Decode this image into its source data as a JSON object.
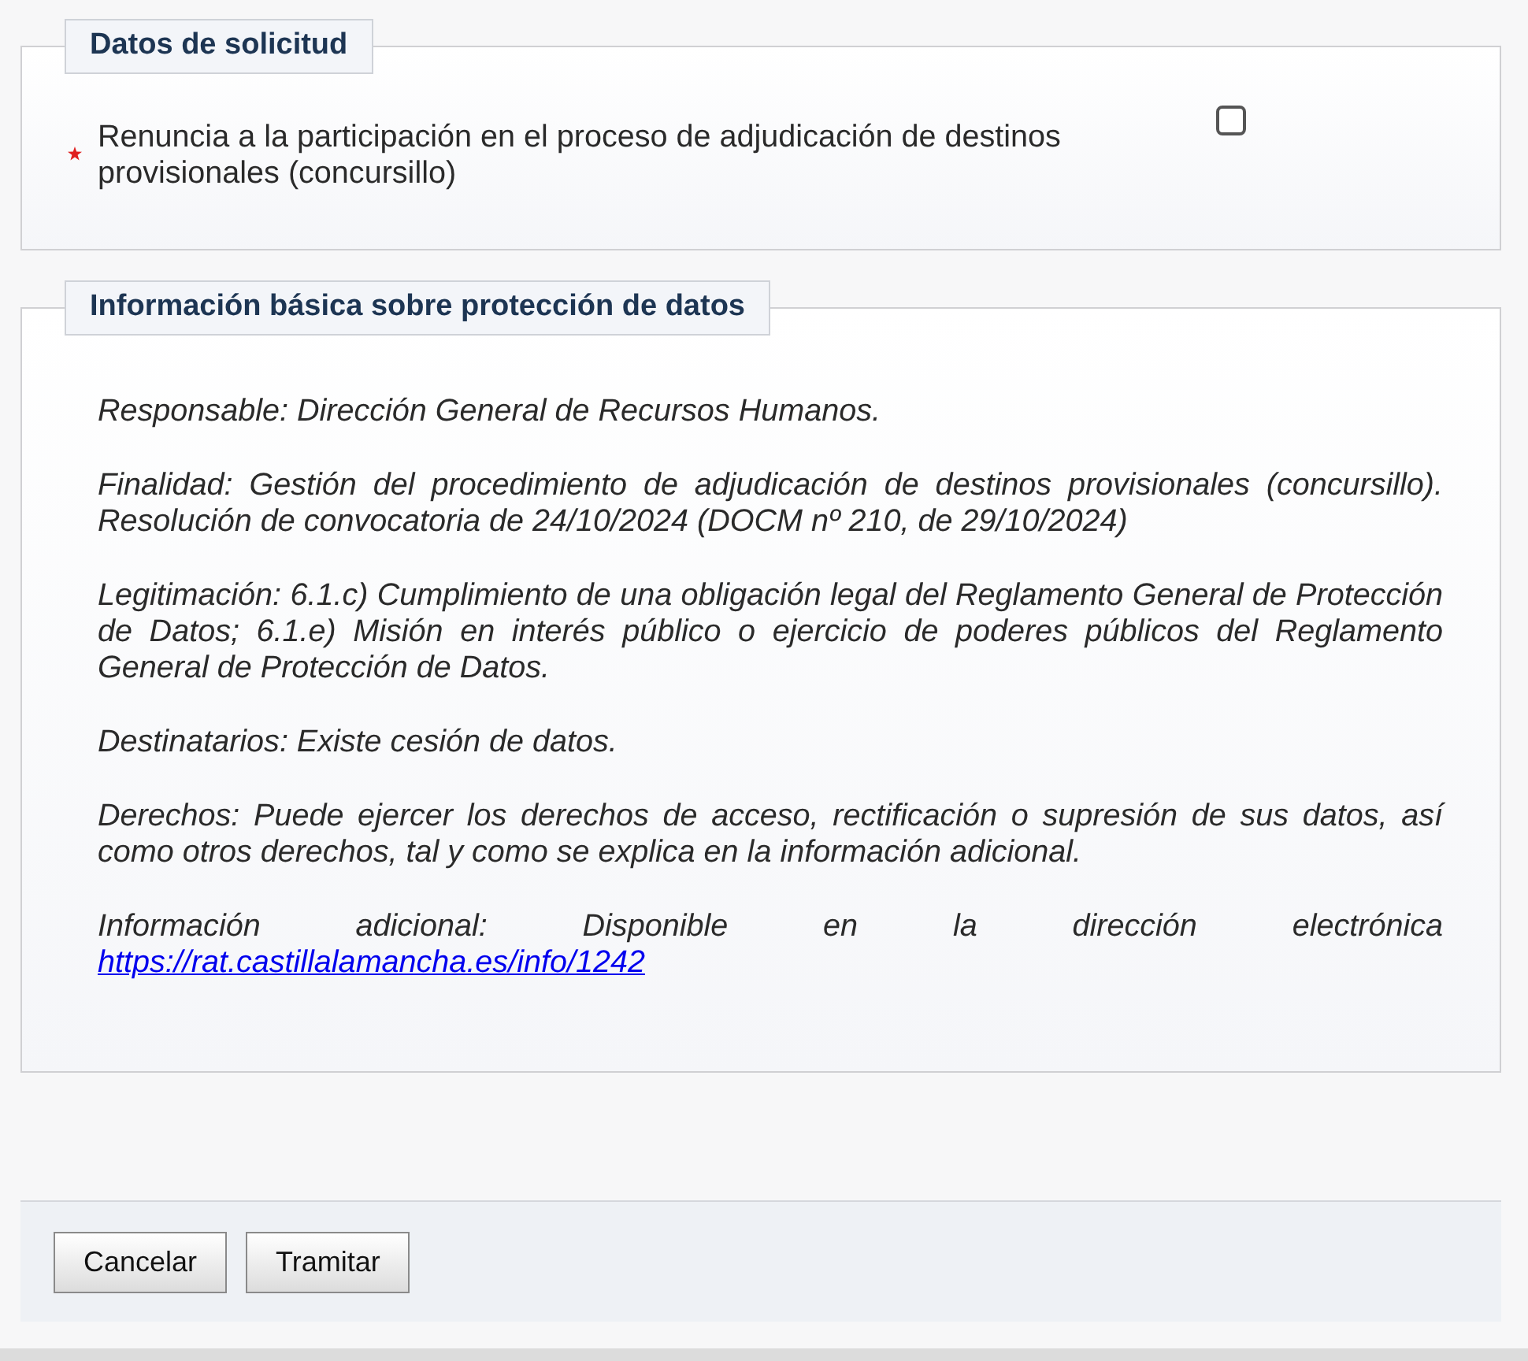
{
  "sections": [
    {
      "kind": "form",
      "legend": "Datos de solicitud",
      "fields": [
        {
          "label": "Renuncia a la participación en el proceso de adjudicación de destinos provisionales (concursillo)",
          "required": true,
          "checked": false
        }
      ]
    },
    {
      "kind": "info",
      "legend": "Información básica sobre protección de datos",
      "paragraphs": [
        {
          "text": "Responsable: Dirección General de Recursos Humanos."
        },
        {
          "text": "Finalidad: Gestión del procedimiento de adjudicación de destinos provisionales (concursillo). Resolución de convocatoria de 24/10/2024 (DOCM nº 210, de 29/10/2024)"
        },
        {
          "text": "Legitimación: 6.1.c) Cumplimiento de una obligación legal del Reglamento General de Protección de Datos; 6.1.e) Misión en interés público o ejercicio de poderes públicos del Reglamento General de Protección de Datos."
        },
        {
          "text": "Destinatarios: Existe cesión de datos."
        },
        {
          "text": "Derechos: Puede ejercer los derechos de acceso, rectificación o supresión de sus datos, así como otros derechos, tal y como se explica en la información adicional."
        },
        {
          "text": "Información adicional: Disponible en la dirección electrónica",
          "link": "https://rat.castillalamancha.es/info/1242"
        }
      ]
    }
  ],
  "buttons": [
    "Cancelar",
    "Tramitar"
  ]
}
